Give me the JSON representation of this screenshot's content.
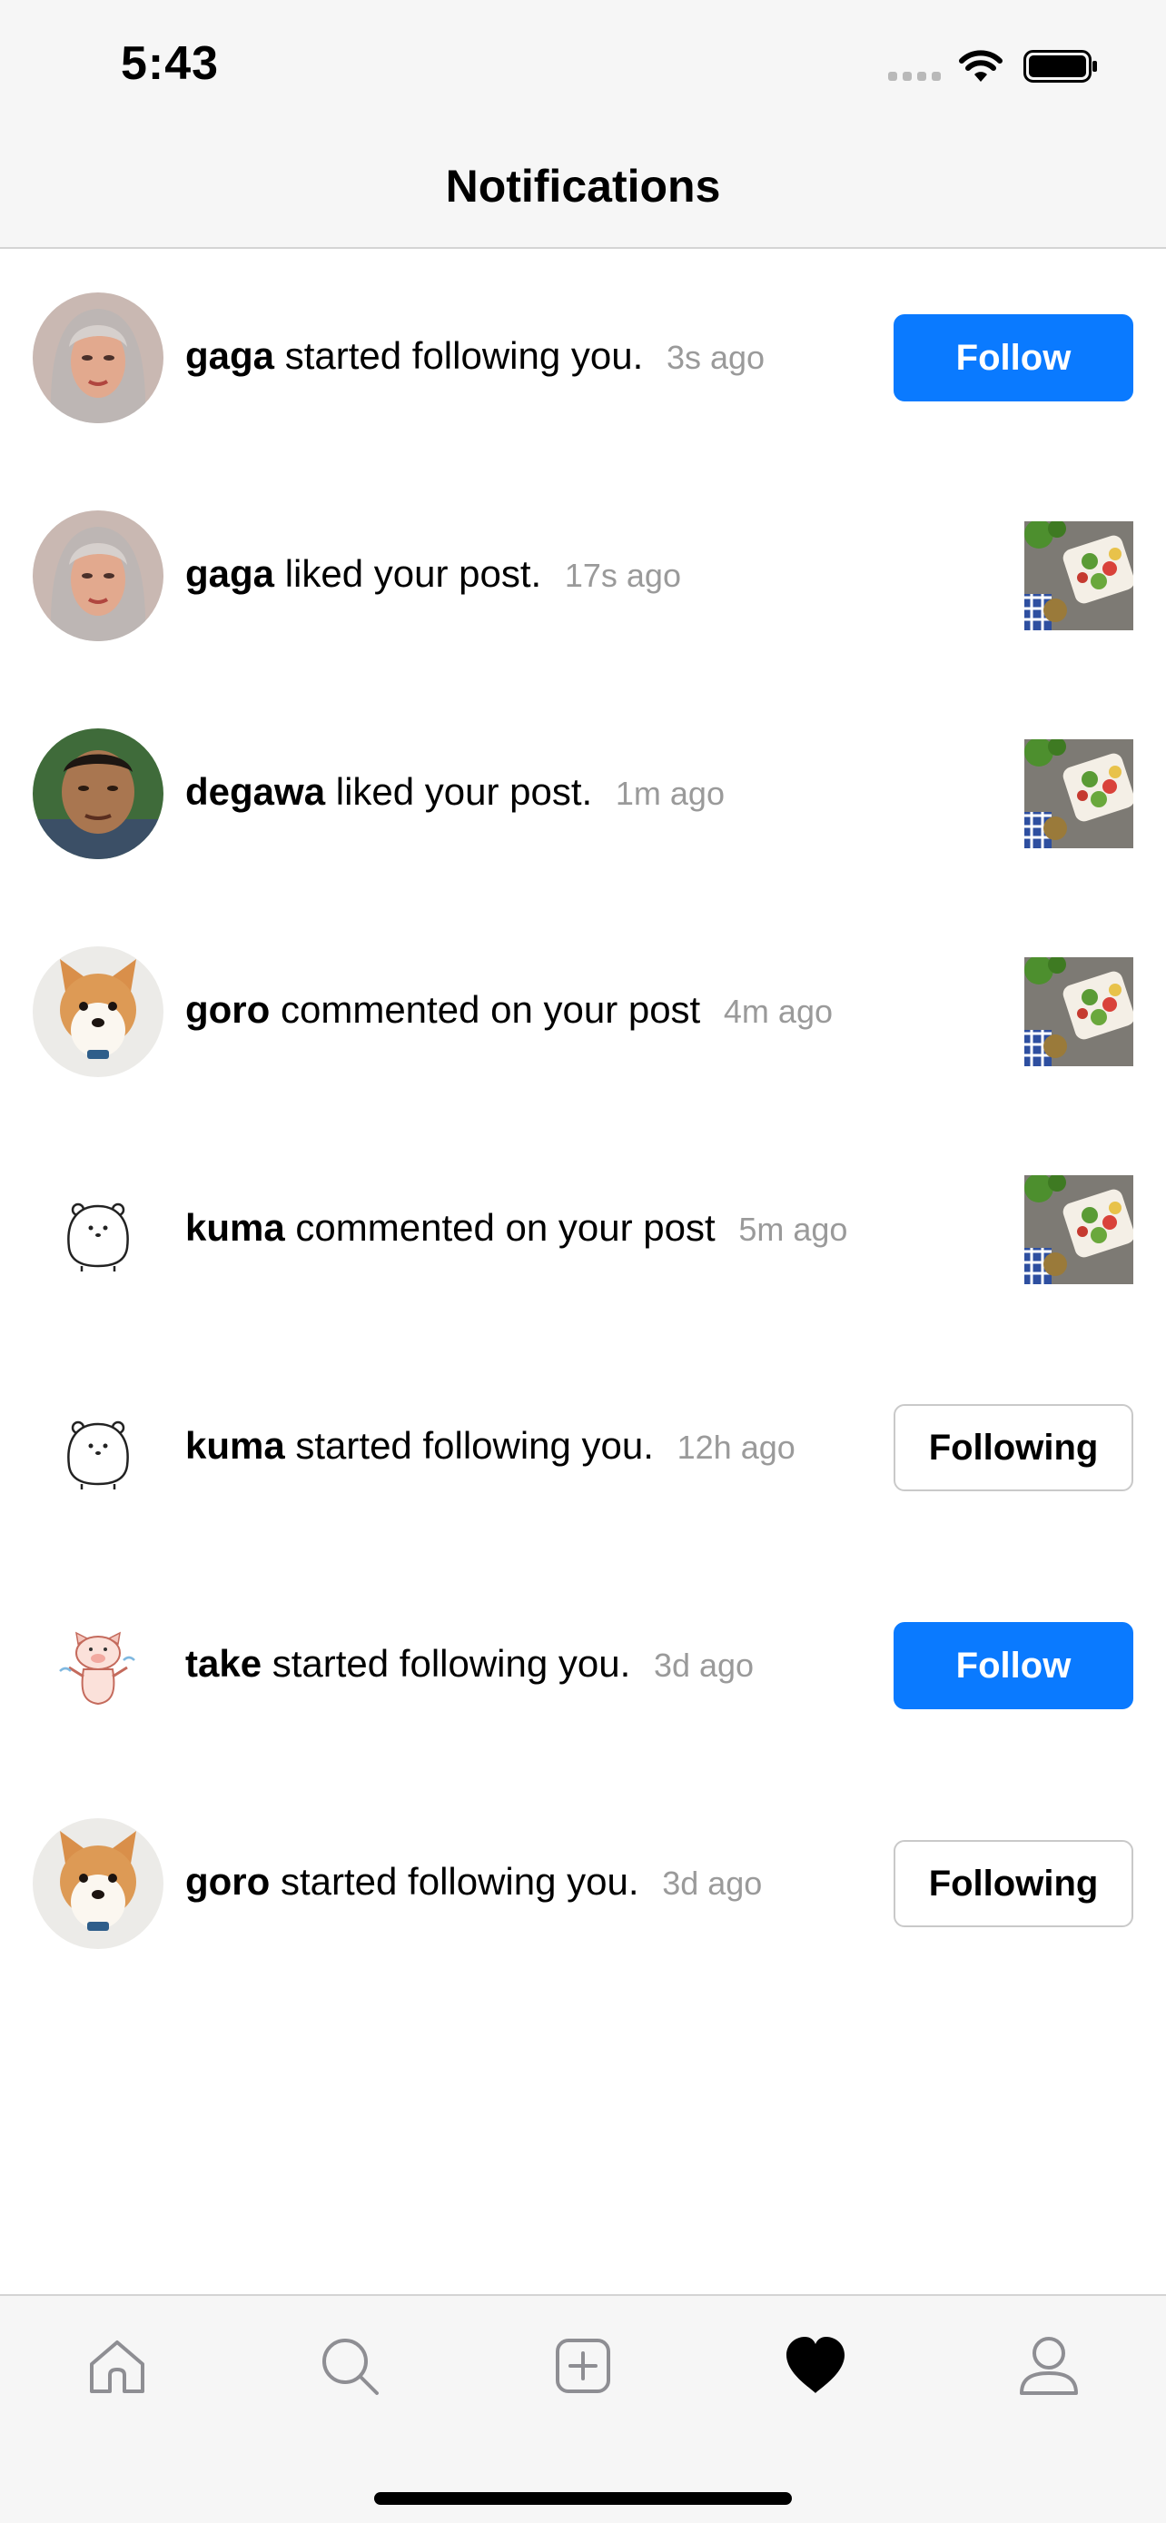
{
  "status_bar": {
    "time": "5:43"
  },
  "nav": {
    "title": "Notifications"
  },
  "notifications": [
    {
      "username": "gaga",
      "text": "started following you.",
      "time": "3s ago",
      "action": "follow",
      "button_label": "Follow"
    },
    {
      "username": "gaga",
      "text": "liked your post.",
      "time": "17s ago",
      "action": "post"
    },
    {
      "username": "degawa",
      "text": "liked your post.",
      "time": "1m ago",
      "action": "post"
    },
    {
      "username": "goro",
      "text": "commented on your post",
      "time": "4m ago",
      "action": "post"
    },
    {
      "username": "kuma",
      "text": "commented on your post",
      "time": "5m ago",
      "action": "post"
    },
    {
      "username": "kuma",
      "text": "started following you.",
      "time": "12h ago",
      "action": "following",
      "button_label": "Following"
    },
    {
      "username": "take",
      "text": "started following you.",
      "time": "3d ago",
      "action": "follow",
      "button_label": "Follow"
    },
    {
      "username": "goro",
      "text": "started following you.",
      "time": "3d ago",
      "action": "following",
      "button_label": "Following"
    }
  ],
  "tab_bar": {
    "tabs": [
      {
        "icon": "home-icon"
      },
      {
        "icon": "search-icon"
      },
      {
        "icon": "add-post-icon"
      },
      {
        "icon": "heart-icon",
        "active": true
      },
      {
        "icon": "profile-icon"
      }
    ]
  },
  "colors": {
    "accent": "#0a7aff",
    "timestamp": "#9a9a9a",
    "bar_background": "#f6f6f6"
  }
}
